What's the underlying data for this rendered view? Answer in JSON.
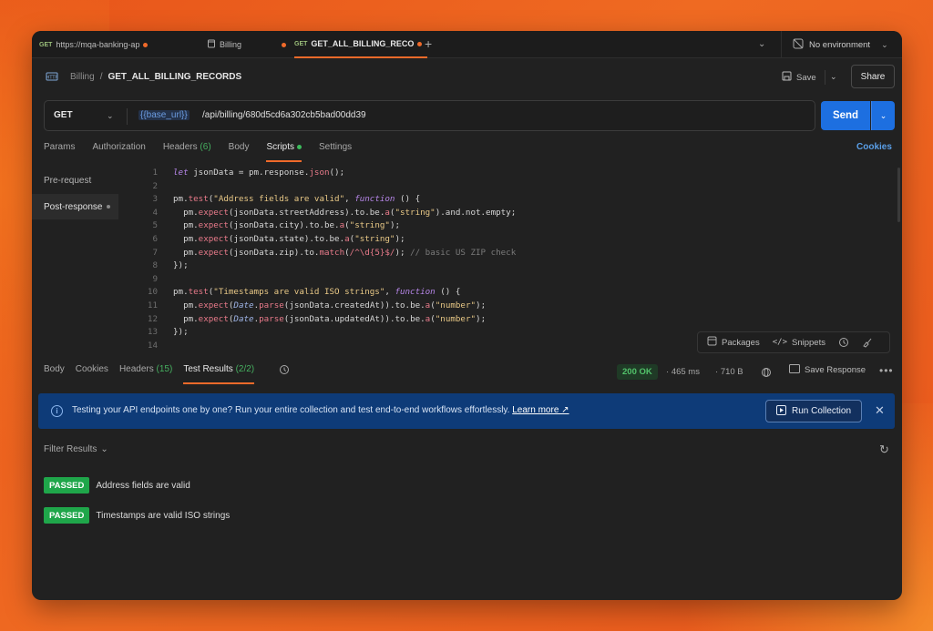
{
  "tabs": [
    {
      "method": "GET",
      "label": "https://mqa-banking-ap",
      "dot": true
    },
    {
      "method": "",
      "label": "Billing",
      "dot": true
    },
    {
      "method": "GET",
      "label": "GET_ALL_BILLING_RECO",
      "dot": true
    }
  ],
  "environment": "No environment",
  "breadcrumb": {
    "parent": "Billing",
    "separator": "/",
    "current": "GET_ALL_BILLING_RECORDS"
  },
  "toolbar": {
    "save_label": "Save",
    "share_label": "Share"
  },
  "request": {
    "method": "GET",
    "url_variable": "{{base_url}}",
    "url_path": "/api/billing/680d5cd6a302cb5bad00dd39",
    "send_label": "Send"
  },
  "request_tabs": [
    {
      "label": "Params",
      "count": ""
    },
    {
      "label": "Authorization",
      "count": ""
    },
    {
      "label": "Headers",
      "count": "(6)"
    },
    {
      "label": "Body",
      "count": ""
    },
    {
      "label": "Scripts",
      "count": ""
    },
    {
      "label": "Settings",
      "count": ""
    }
  ],
  "cookies_label": "Cookies",
  "script_sidebar": {
    "pre": "Pre-request",
    "post": "Post-response"
  },
  "code_lines": [
    "1",
    "2",
    "3",
    "4",
    "5",
    "6",
    "7",
    "8",
    "9",
    "10",
    "11",
    "12",
    "13",
    "14"
  ],
  "snippets_bar": {
    "packages": "Packages",
    "snippets": "Snippets"
  },
  "response_tabs": [
    {
      "label": "Body",
      "count": ""
    },
    {
      "label": "Cookies",
      "count": ""
    },
    {
      "label": "Headers",
      "count": "(15)"
    },
    {
      "label": "Test Results",
      "count": "(2/2)"
    }
  ],
  "response_meta": {
    "status": "200 OK",
    "time": "465 ms",
    "size": "710 B",
    "save_response": "Save Response"
  },
  "banner": {
    "text": "Testing your API endpoints one by one? Run your entire collection and test end-to-end workflows effortlessly.",
    "link": "Learn more ↗",
    "button": "Run Collection"
  },
  "filter_label": "Filter Results",
  "test_results": [
    {
      "status": "PASSED",
      "name": "Address fields are valid"
    },
    {
      "status": "PASSED",
      "name": "Timestamps are valid ISO strings"
    }
  ],
  "colors": {
    "accent": "#f06a2a",
    "send": "#1d6fe0",
    "passed": "#1fa64a",
    "banner": "#0e3b78"
  }
}
